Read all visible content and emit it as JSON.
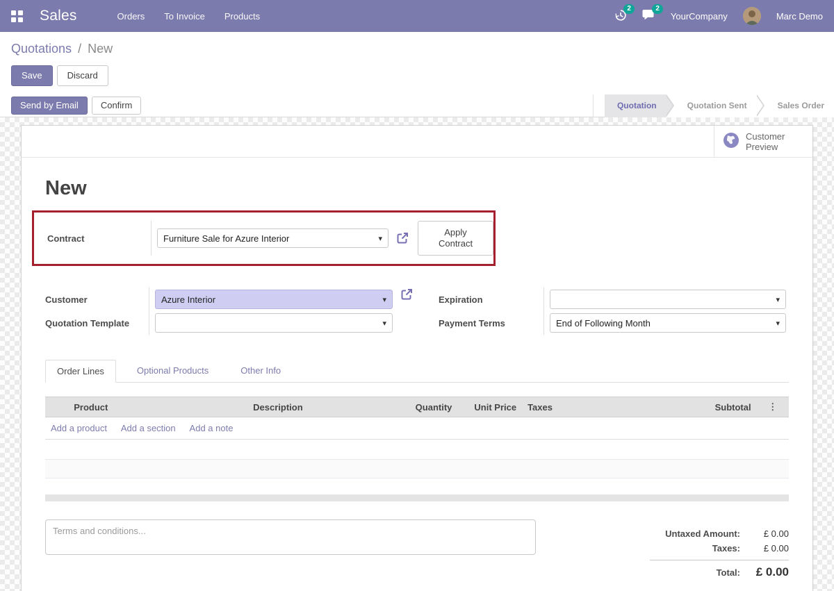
{
  "navbar": {
    "brand": "Sales",
    "menus": [
      {
        "label": "Orders"
      },
      {
        "label": "To Invoice"
      },
      {
        "label": "Products"
      }
    ],
    "activity_badge": "2",
    "messages_badge": "2",
    "company": "YourCompany",
    "user": "Marc Demo",
    "colors": {
      "navbar_bg": "#7c7bad",
      "badge_bg": "#0fa699"
    }
  },
  "breadcrumb": {
    "parent": "Quotations",
    "separator": "/",
    "current": "New"
  },
  "control_buttons": {
    "save": "Save",
    "discard": "Discard"
  },
  "status_row": {
    "send_by_email": "Send by Email",
    "confirm": "Confirm",
    "stages": [
      {
        "label": "Quotation",
        "active": true
      },
      {
        "label": "Quotation Sent",
        "active": false
      },
      {
        "label": "Sales Order",
        "active": false
      }
    ]
  },
  "sheet": {
    "preview_button": "Customer Preview",
    "title": "New",
    "contract": {
      "label": "Contract",
      "value": "Furniture Sale for Azure Interior",
      "apply_button": "Apply Contract",
      "highlight_color": "#a4202c"
    },
    "fields": {
      "customer": {
        "label": "Customer",
        "value": "Azure Interior",
        "selected_bg": "#cfcef2"
      },
      "quotation_template": {
        "label": "Quotation Template",
        "value": ""
      },
      "expiration": {
        "label": "Expiration",
        "value": ""
      },
      "payment_terms": {
        "label": "Payment Terms",
        "value": "End of Following Month"
      }
    },
    "tabs": [
      {
        "label": "Order Lines",
        "active": true
      },
      {
        "label": "Optional Products",
        "active": false
      },
      {
        "label": "Other Info",
        "active": false
      }
    ],
    "order_lines": {
      "columns": [
        "Product",
        "Description",
        "Quantity",
        "Unit Price",
        "Taxes",
        "Subtotal"
      ],
      "add_links": [
        "Add a product",
        "Add a section",
        "Add a note"
      ],
      "rows": []
    },
    "terms_placeholder": "Terms and conditions...",
    "totals": {
      "untaxed_label": "Untaxed Amount:",
      "untaxed_value": "£ 0.00",
      "taxes_label": "Taxes:",
      "taxes_value": "£ 0.00",
      "total_label": "Total:",
      "total_value": "£ 0.00"
    }
  },
  "icons": {
    "apps": "grid",
    "activity": "clock",
    "messages": "chat-bubble",
    "customer_preview": "globe",
    "external_link": "arrow-out-of-box",
    "dropdown_caret": "▾",
    "column_options": "⋮"
  }
}
